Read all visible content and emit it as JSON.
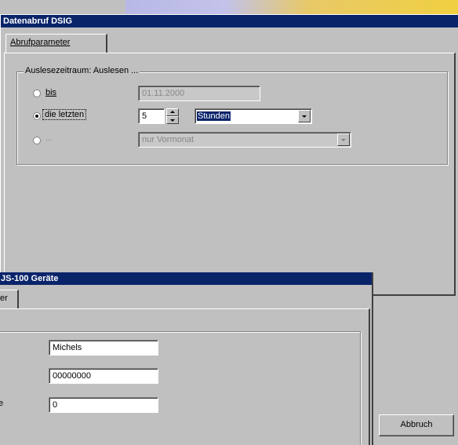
{
  "background_window": {
    "title": "Datenabruf DSIG",
    "tab_label": "Abrufparameter",
    "group_title": "Auslesezeitraum: Auslesen ...",
    "option_bis": {
      "label": "bis",
      "checked": false,
      "date_value": "01.11.2000"
    },
    "option_letzten": {
      "label": "die letzten",
      "checked": true,
      "count_value": "5",
      "unit_value": "Stunden"
    },
    "option_other": {
      "label": "...",
      "checked": false,
      "selection_value": "nur Vormonat"
    },
    "cancel_button": "Abbruch"
  },
  "foreground_window": {
    "title_visible": "JS-100 Geräte",
    "tab_visible": "er",
    "fields": [
      {
        "label_visible": "",
        "value": "Michels"
      },
      {
        "label_visible": "",
        "value": "00000000"
      },
      {
        "label_visible": "e",
        "value": "0"
      }
    ]
  },
  "colors": {
    "titlebar": "#0a246a",
    "face": "#c0c0c0",
    "selection": "#0a246a"
  }
}
